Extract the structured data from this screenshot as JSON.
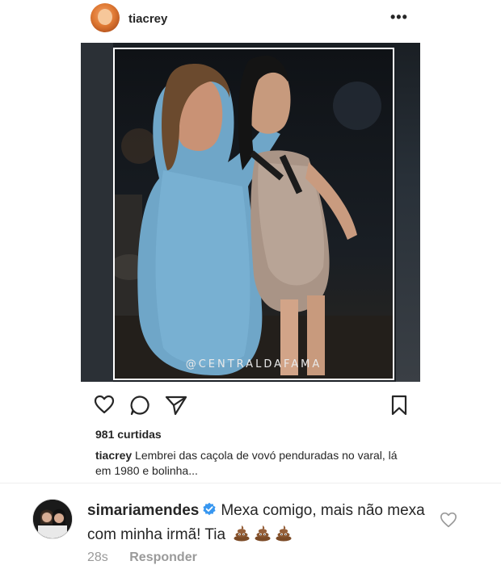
{
  "post": {
    "username": "tiacrey",
    "more_label": "•••",
    "image_watermark": "@CENTRALDAFAMA",
    "likes": "981 curtidas",
    "caption_user": "tiacrey",
    "caption_text": "Lembrei das caçola de vovó penduradas no varal, lá em 1980 e bolinha..."
  },
  "icons": {
    "like": "heart-outline-icon",
    "comment": "comment-bubble-icon",
    "share": "paper-plane-icon",
    "save": "bookmark-icon",
    "verified": "verified-badge-icon",
    "emoji": "pile-of-poo-emoji",
    "comment_like": "small-heart-icon"
  },
  "comment": {
    "username": "simariamendes",
    "text": "Mexa comigo, mais não mexa com minha irmã! Tia",
    "time": "28s",
    "reply_label": "Responder"
  },
  "colors": {
    "text": "#262626",
    "muted": "#9a9a9a",
    "verified": "#3897f0",
    "poo": "#7b4a26"
  }
}
